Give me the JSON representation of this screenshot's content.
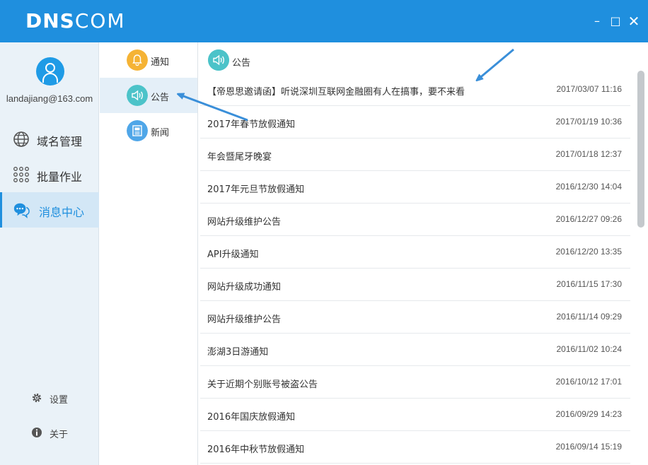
{
  "app": {
    "logo_bold": "DNS",
    "logo_light": "COM",
    "min_symbol": "–",
    "max_symbol": "□",
    "close_symbol": "✕"
  },
  "user": {
    "email": "landajiang@163.com"
  },
  "leftnav": {
    "items": [
      {
        "label": "域名管理",
        "icon": "globe-icon"
      },
      {
        "label": "批量作业",
        "icon": "dots-grid-icon"
      },
      {
        "label": "消息中心",
        "icon": "chat-bubbles-icon",
        "active": true
      }
    ],
    "settings_label": "设置",
    "about_label": "关于"
  },
  "subnav": {
    "items": [
      {
        "label": "通知",
        "icon": "bell-icon",
        "color": "#f5b335"
      },
      {
        "label": "公告",
        "icon": "speaker-icon",
        "color": "#4cc3c9",
        "active": true
      },
      {
        "label": "新闻",
        "icon": "news-icon",
        "color": "#4fa6e8"
      }
    ]
  },
  "content": {
    "title": "公告",
    "rows": [
      {
        "title": "【帝恩思邀请函】听说深圳互联网金融圈有人在搞事，要不来看",
        "date": "2017/03/07 11:16"
      },
      {
        "title": "2017年春节放假通知",
        "date": "2017/01/19 10:36"
      },
      {
        "title": "年会暨尾牙晚宴",
        "date": "2017/01/18 12:37"
      },
      {
        "title": "2017年元旦节放假通知",
        "date": "2016/12/30 14:04"
      },
      {
        "title": "网站升级维护公告",
        "date": "2016/12/27 09:26"
      },
      {
        "title": "API升级通知",
        "date": "2016/12/20 13:35"
      },
      {
        "title": "网站升级成功通知",
        "date": "2016/11/15 17:30"
      },
      {
        "title": "网站升级维护公告",
        "date": "2016/11/14 09:29"
      },
      {
        "title": "澎湖3日游通知",
        "date": "2016/11/02 10:24"
      },
      {
        "title": "关于近期个别账号被盗公告",
        "date": "2016/10/12 17:01"
      },
      {
        "title": "2016年国庆放假通知",
        "date": "2016/09/29 14:23"
      },
      {
        "title": "2016年中秋节放假通知",
        "date": "2016/09/14 15:19"
      }
    ]
  },
  "colors": {
    "accent": "#1f8fde",
    "arrow": "#3a8fd9"
  }
}
